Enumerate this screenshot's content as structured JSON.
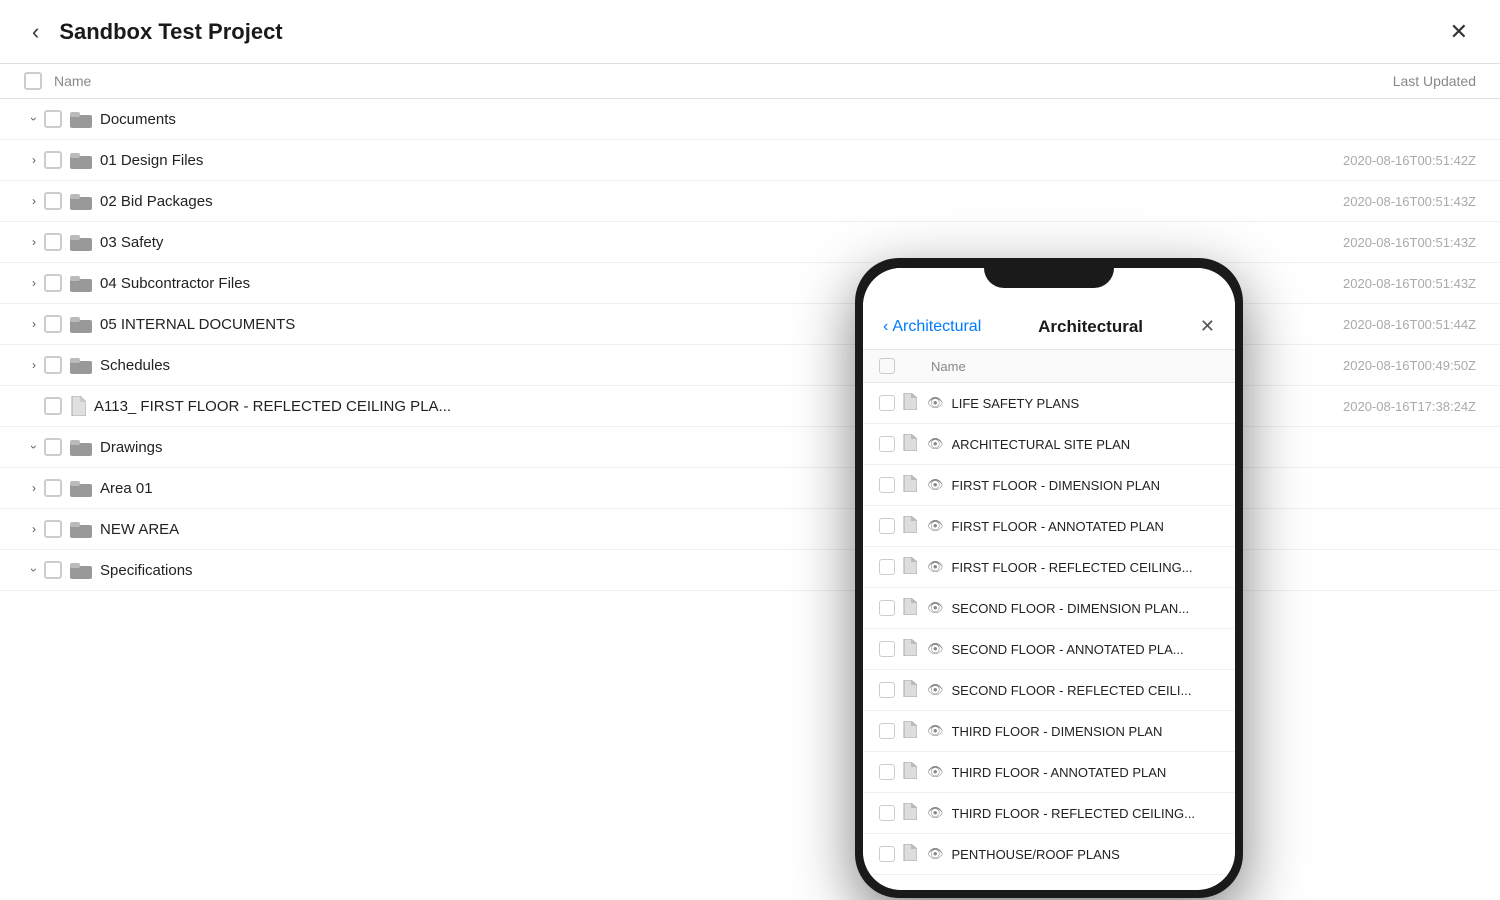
{
  "header": {
    "title": "Sandbox Test Project",
    "back_label": "‹",
    "close_label": "✕"
  },
  "columns": {
    "name": "Name",
    "last_updated": "Last Updated"
  },
  "tree": [
    {
      "id": "documents",
      "type": "folder",
      "expanded": true,
      "indent": 0,
      "name": "Documents",
      "date": ""
    },
    {
      "id": "design-files",
      "type": "folder",
      "expanded": false,
      "indent": 1,
      "name": "01 Design Files",
      "date": "2020-08-16T00:51:42Z"
    },
    {
      "id": "bid-packages",
      "type": "folder",
      "expanded": false,
      "indent": 1,
      "name": "02 Bid Packages",
      "date": "2020-08-16T00:51:43Z"
    },
    {
      "id": "safety",
      "type": "folder",
      "expanded": false,
      "indent": 1,
      "name": "03 Safety",
      "date": "2020-08-16T00:51:43Z"
    },
    {
      "id": "subcontractor",
      "type": "folder",
      "expanded": false,
      "indent": 1,
      "name": "04 Subcontractor Files",
      "date": "2020-08-16T00:51:43Z"
    },
    {
      "id": "internal",
      "type": "folder",
      "expanded": false,
      "indent": 1,
      "name": "05 INTERNAL DOCUMENTS",
      "date": "2020-08-16T00:51:44Z"
    },
    {
      "id": "schedules",
      "type": "folder",
      "expanded": false,
      "indent": 1,
      "name": "Schedules",
      "date": "2020-08-16T00:49:50Z"
    },
    {
      "id": "ceiling-plan",
      "type": "file",
      "indent": 1,
      "name": "A113_ FIRST FLOOR - REFLECTED CEILING PLA...",
      "date": "2020-08-16T17:38:24Z"
    },
    {
      "id": "drawings",
      "type": "folder",
      "expanded": true,
      "indent": 0,
      "name": "Drawings",
      "date": ""
    },
    {
      "id": "area01",
      "type": "folder",
      "expanded": false,
      "indent": 1,
      "name": "Area 01",
      "date": ""
    },
    {
      "id": "new-area",
      "type": "folder",
      "expanded": false,
      "indent": 1,
      "name": "NEW AREA",
      "date": ""
    },
    {
      "id": "specifications",
      "type": "folder",
      "expanded": true,
      "indent": 0,
      "name": "Specifications",
      "date": ""
    }
  ],
  "phone": {
    "header": {
      "back_label": "‹",
      "back_text": "Architectural",
      "close_label": "✕"
    },
    "columns": {
      "name": "Name"
    },
    "files": [
      {
        "name": "LIFE SAFETY PLANS"
      },
      {
        "name": "ARCHITECTURAL SITE PLAN"
      },
      {
        "name": "FIRST FLOOR - DIMENSION PLAN"
      },
      {
        "name": "FIRST FLOOR - ANNOTATED PLAN"
      },
      {
        "name": "FIRST FLOOR - REFLECTED CEILING..."
      },
      {
        "name": "SECOND FLOOR - DIMENSION PLAN..."
      },
      {
        "name": "SECOND FLOOR - ANNOTATED PLA..."
      },
      {
        "name": "SECOND FLOOR - REFLECTED CEILI..."
      },
      {
        "name": "THIRD FLOOR - DIMENSION PLAN"
      },
      {
        "name": "THIRD FLOOR - ANNOTATED PLAN"
      },
      {
        "name": "THIRD FLOOR - REFLECTED CEILING..."
      },
      {
        "name": "PENTHOUSE/ROOF PLANS"
      }
    ]
  }
}
